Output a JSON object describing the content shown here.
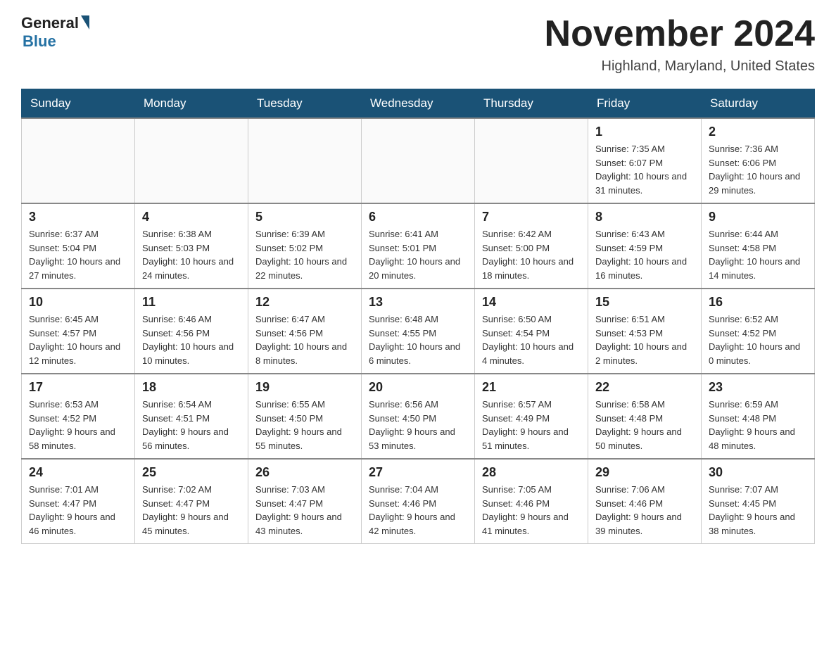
{
  "header": {
    "logo_text_general": "General",
    "logo_text_blue": "Blue",
    "calendar_title": "November 2024",
    "calendar_subtitle": "Highland, Maryland, United States"
  },
  "weekdays": [
    "Sunday",
    "Monday",
    "Tuesday",
    "Wednesday",
    "Thursday",
    "Friday",
    "Saturday"
  ],
  "weeks": [
    {
      "days": [
        {
          "num": "",
          "sunrise": "",
          "sunset": "",
          "daylight": "",
          "empty": true
        },
        {
          "num": "",
          "sunrise": "",
          "sunset": "",
          "daylight": "",
          "empty": true
        },
        {
          "num": "",
          "sunrise": "",
          "sunset": "",
          "daylight": "",
          "empty": true
        },
        {
          "num": "",
          "sunrise": "",
          "sunset": "",
          "daylight": "",
          "empty": true
        },
        {
          "num": "",
          "sunrise": "",
          "sunset": "",
          "daylight": "",
          "empty": true
        },
        {
          "num": "1",
          "sunrise": "Sunrise: 7:35 AM",
          "sunset": "Sunset: 6:07 PM",
          "daylight": "Daylight: 10 hours and 31 minutes.",
          "empty": false
        },
        {
          "num": "2",
          "sunrise": "Sunrise: 7:36 AM",
          "sunset": "Sunset: 6:06 PM",
          "daylight": "Daylight: 10 hours and 29 minutes.",
          "empty": false
        }
      ]
    },
    {
      "days": [
        {
          "num": "3",
          "sunrise": "Sunrise: 6:37 AM",
          "sunset": "Sunset: 5:04 PM",
          "daylight": "Daylight: 10 hours and 27 minutes.",
          "empty": false
        },
        {
          "num": "4",
          "sunrise": "Sunrise: 6:38 AM",
          "sunset": "Sunset: 5:03 PM",
          "daylight": "Daylight: 10 hours and 24 minutes.",
          "empty": false
        },
        {
          "num": "5",
          "sunrise": "Sunrise: 6:39 AM",
          "sunset": "Sunset: 5:02 PM",
          "daylight": "Daylight: 10 hours and 22 minutes.",
          "empty": false
        },
        {
          "num": "6",
          "sunrise": "Sunrise: 6:41 AM",
          "sunset": "Sunset: 5:01 PM",
          "daylight": "Daylight: 10 hours and 20 minutes.",
          "empty": false
        },
        {
          "num": "7",
          "sunrise": "Sunrise: 6:42 AM",
          "sunset": "Sunset: 5:00 PM",
          "daylight": "Daylight: 10 hours and 18 minutes.",
          "empty": false
        },
        {
          "num": "8",
          "sunrise": "Sunrise: 6:43 AM",
          "sunset": "Sunset: 4:59 PM",
          "daylight": "Daylight: 10 hours and 16 minutes.",
          "empty": false
        },
        {
          "num": "9",
          "sunrise": "Sunrise: 6:44 AM",
          "sunset": "Sunset: 4:58 PM",
          "daylight": "Daylight: 10 hours and 14 minutes.",
          "empty": false
        }
      ]
    },
    {
      "days": [
        {
          "num": "10",
          "sunrise": "Sunrise: 6:45 AM",
          "sunset": "Sunset: 4:57 PM",
          "daylight": "Daylight: 10 hours and 12 minutes.",
          "empty": false
        },
        {
          "num": "11",
          "sunrise": "Sunrise: 6:46 AM",
          "sunset": "Sunset: 4:56 PM",
          "daylight": "Daylight: 10 hours and 10 minutes.",
          "empty": false
        },
        {
          "num": "12",
          "sunrise": "Sunrise: 6:47 AM",
          "sunset": "Sunset: 4:56 PM",
          "daylight": "Daylight: 10 hours and 8 minutes.",
          "empty": false
        },
        {
          "num": "13",
          "sunrise": "Sunrise: 6:48 AM",
          "sunset": "Sunset: 4:55 PM",
          "daylight": "Daylight: 10 hours and 6 minutes.",
          "empty": false
        },
        {
          "num": "14",
          "sunrise": "Sunrise: 6:50 AM",
          "sunset": "Sunset: 4:54 PM",
          "daylight": "Daylight: 10 hours and 4 minutes.",
          "empty": false
        },
        {
          "num": "15",
          "sunrise": "Sunrise: 6:51 AM",
          "sunset": "Sunset: 4:53 PM",
          "daylight": "Daylight: 10 hours and 2 minutes.",
          "empty": false
        },
        {
          "num": "16",
          "sunrise": "Sunrise: 6:52 AM",
          "sunset": "Sunset: 4:52 PM",
          "daylight": "Daylight: 10 hours and 0 minutes.",
          "empty": false
        }
      ]
    },
    {
      "days": [
        {
          "num": "17",
          "sunrise": "Sunrise: 6:53 AM",
          "sunset": "Sunset: 4:52 PM",
          "daylight": "Daylight: 9 hours and 58 minutes.",
          "empty": false
        },
        {
          "num": "18",
          "sunrise": "Sunrise: 6:54 AM",
          "sunset": "Sunset: 4:51 PM",
          "daylight": "Daylight: 9 hours and 56 minutes.",
          "empty": false
        },
        {
          "num": "19",
          "sunrise": "Sunrise: 6:55 AM",
          "sunset": "Sunset: 4:50 PM",
          "daylight": "Daylight: 9 hours and 55 minutes.",
          "empty": false
        },
        {
          "num": "20",
          "sunrise": "Sunrise: 6:56 AM",
          "sunset": "Sunset: 4:50 PM",
          "daylight": "Daylight: 9 hours and 53 minutes.",
          "empty": false
        },
        {
          "num": "21",
          "sunrise": "Sunrise: 6:57 AM",
          "sunset": "Sunset: 4:49 PM",
          "daylight": "Daylight: 9 hours and 51 minutes.",
          "empty": false
        },
        {
          "num": "22",
          "sunrise": "Sunrise: 6:58 AM",
          "sunset": "Sunset: 4:48 PM",
          "daylight": "Daylight: 9 hours and 50 minutes.",
          "empty": false
        },
        {
          "num": "23",
          "sunrise": "Sunrise: 6:59 AM",
          "sunset": "Sunset: 4:48 PM",
          "daylight": "Daylight: 9 hours and 48 minutes.",
          "empty": false
        }
      ]
    },
    {
      "days": [
        {
          "num": "24",
          "sunrise": "Sunrise: 7:01 AM",
          "sunset": "Sunset: 4:47 PM",
          "daylight": "Daylight: 9 hours and 46 minutes.",
          "empty": false
        },
        {
          "num": "25",
          "sunrise": "Sunrise: 7:02 AM",
          "sunset": "Sunset: 4:47 PM",
          "daylight": "Daylight: 9 hours and 45 minutes.",
          "empty": false
        },
        {
          "num": "26",
          "sunrise": "Sunrise: 7:03 AM",
          "sunset": "Sunset: 4:47 PM",
          "daylight": "Daylight: 9 hours and 43 minutes.",
          "empty": false
        },
        {
          "num": "27",
          "sunrise": "Sunrise: 7:04 AM",
          "sunset": "Sunset: 4:46 PM",
          "daylight": "Daylight: 9 hours and 42 minutes.",
          "empty": false
        },
        {
          "num": "28",
          "sunrise": "Sunrise: 7:05 AM",
          "sunset": "Sunset: 4:46 PM",
          "daylight": "Daylight: 9 hours and 41 minutes.",
          "empty": false
        },
        {
          "num": "29",
          "sunrise": "Sunrise: 7:06 AM",
          "sunset": "Sunset: 4:46 PM",
          "daylight": "Daylight: 9 hours and 39 minutes.",
          "empty": false
        },
        {
          "num": "30",
          "sunrise": "Sunrise: 7:07 AM",
          "sunset": "Sunset: 4:45 PM",
          "daylight": "Daylight: 9 hours and 38 minutes.",
          "empty": false
        }
      ]
    }
  ]
}
